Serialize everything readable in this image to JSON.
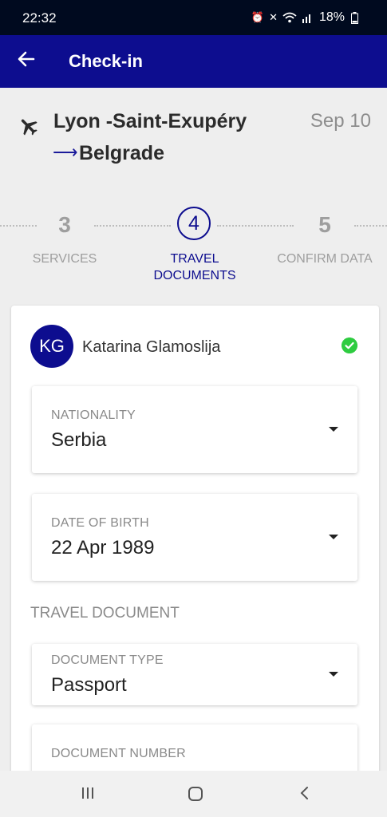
{
  "status_bar": {
    "time": "22:32",
    "battery": "18%"
  },
  "app_bar": {
    "title": "Check-in"
  },
  "route": {
    "from": "Lyon -Saint-Exupéry",
    "arrow": "⟶",
    "to": "Belgrade",
    "date": "Sep 10"
  },
  "stepper": {
    "steps": [
      {
        "number": "3",
        "label": "SERVICES"
      },
      {
        "number": "4",
        "label_line1": "TRAVEL",
        "label_line2": "DOCUMENTS"
      },
      {
        "number": "5",
        "label": "CONFIRM DATA"
      }
    ]
  },
  "passenger": {
    "initials": "KG",
    "name": "Katarina Glamoslija"
  },
  "fields": {
    "nationality": {
      "label": "NATIONALITY",
      "value": "Serbia"
    },
    "date_of_birth": {
      "label": "DATE OF BIRTH",
      "value": "22 Apr 1989"
    },
    "section_title": "TRAVEL DOCUMENT",
    "document_type": {
      "label": "DOCUMENT TYPE",
      "value": "Passport"
    },
    "document_number": {
      "label": "DOCUMENT NUMBER"
    }
  },
  "colors": {
    "primary": "#0d0d8f",
    "status_bar": "#000a1f",
    "success": "#2ecc40",
    "muted": "#9e9e9e"
  }
}
